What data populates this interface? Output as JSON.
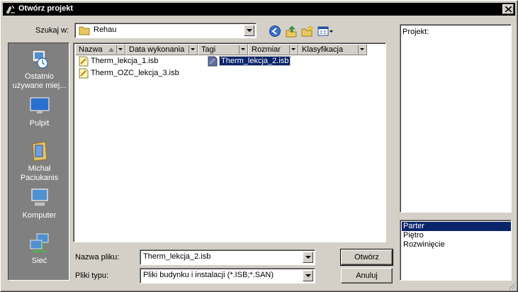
{
  "window": {
    "title": "Otwórz projekt"
  },
  "look_in": {
    "label": "Szukaj w:",
    "value": "Rehau"
  },
  "places": [
    {
      "label": "Ostatnio używane miej..."
    },
    {
      "label": "Pulpit"
    },
    {
      "label": "Michał Paciukanis"
    },
    {
      "label": "Komputer"
    },
    {
      "label": "Sieć"
    }
  ],
  "columns": [
    "Nazwa",
    "Data wykonania",
    "Tagi",
    "Rozmiar",
    "Klasyfikacja"
  ],
  "files": [
    {
      "name": "Therm_lekcja_1.isb",
      "selected": false
    },
    {
      "name": "Therm_OZC_lekcja_3.isb",
      "selected": false
    },
    {
      "name": "Therm_lekcja_2.isb",
      "selected": true
    }
  ],
  "filename": {
    "label": "Nazwa pliku:",
    "value": "Therm_lekcja_2.isb"
  },
  "filetype": {
    "label": "Pliki typu:",
    "value": "Pliki budynku i instalacji (*.ISB;*.SAN)"
  },
  "buttons": {
    "open": "Otwórz",
    "cancel": "Anuluj"
  },
  "project_panel": {
    "label": "Projekt:"
  },
  "levels": [
    "Parter",
    "Piętro",
    "Rozwinięcie"
  ],
  "colors": {
    "titlebar": "#000000",
    "selection": "#0a246a",
    "face": "#d4d0c8"
  }
}
